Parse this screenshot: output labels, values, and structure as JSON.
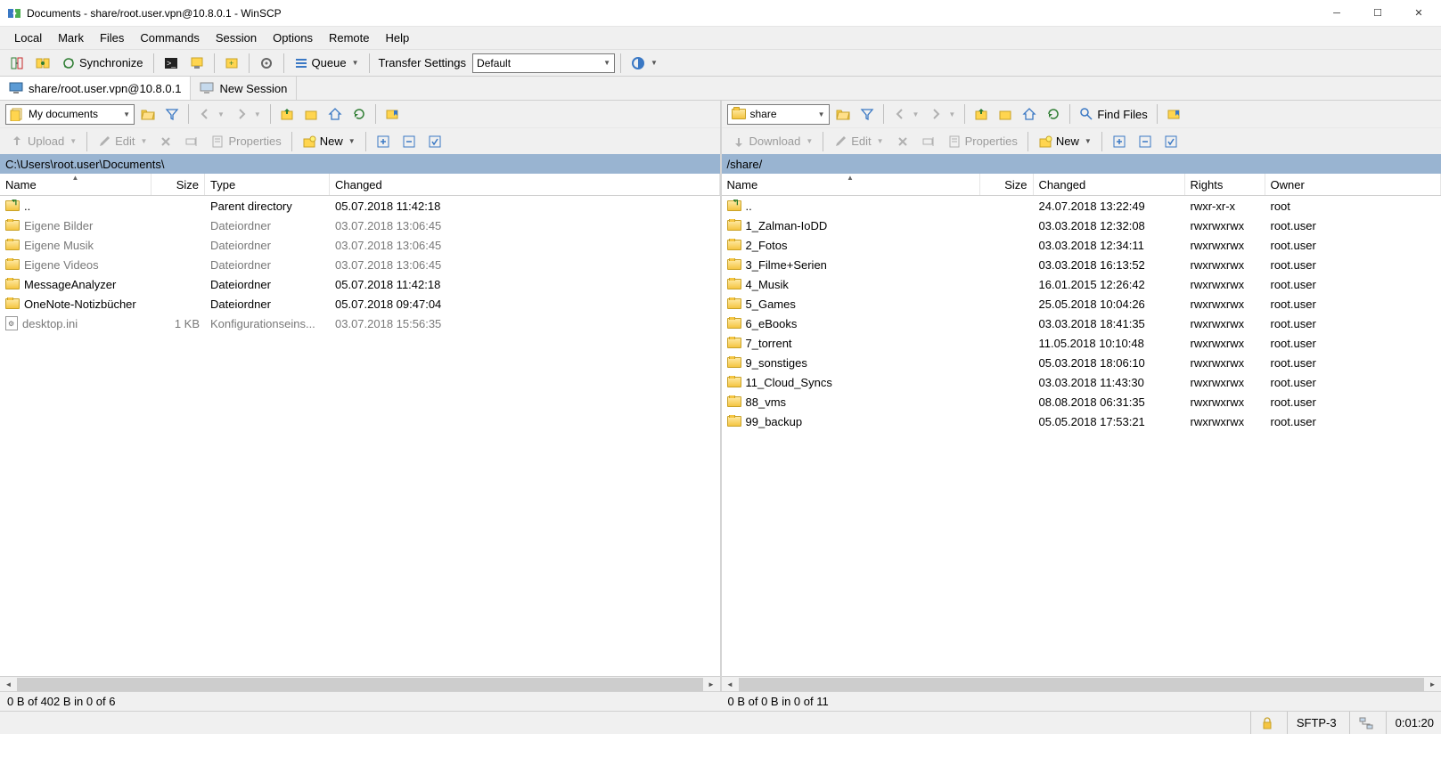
{
  "window": {
    "title": "Documents - share/root.user.vpn@10.8.0.1 - WinSCP"
  },
  "menubar": [
    "Local",
    "Mark",
    "Files",
    "Commands",
    "Session",
    "Options",
    "Remote",
    "Help"
  ],
  "toolbar1": {
    "synchronize": "Synchronize",
    "queue": "Queue",
    "transfer_label": "Transfer Settings",
    "transfer_value": "Default"
  },
  "sessions": {
    "active": "share/root.user.vpn@10.8.0.1",
    "new": "New Session"
  },
  "local": {
    "drive_label": "My documents",
    "actions": {
      "upload": "Upload",
      "edit": "Edit",
      "properties": "Properties",
      "new": "New"
    },
    "path": "C:\\Users\\root.user\\Documents\\",
    "headers": [
      "Name",
      "Size",
      "Type",
      "Changed"
    ],
    "rows": [
      {
        "icon": "up",
        "name": "..",
        "size": "",
        "type": "Parent directory",
        "changed": "05.07.2018  11:42:18",
        "dim": false
      },
      {
        "icon": "folder",
        "name": "Eigene Bilder",
        "size": "",
        "type": "Dateiordner",
        "changed": "03.07.2018  13:06:45",
        "dim": true
      },
      {
        "icon": "folder",
        "name": "Eigene Musik",
        "size": "",
        "type": "Dateiordner",
        "changed": "03.07.2018  13:06:45",
        "dim": true
      },
      {
        "icon": "folder",
        "name": "Eigene Videos",
        "size": "",
        "type": "Dateiordner",
        "changed": "03.07.2018  13:06:45",
        "dim": true
      },
      {
        "icon": "folder",
        "name": "MessageAnalyzer",
        "size": "",
        "type": "Dateiordner",
        "changed": "05.07.2018  11:42:18",
        "dim": false
      },
      {
        "icon": "folder",
        "name": "OneNote-Notizbücher",
        "size": "",
        "type": "Dateiordner",
        "changed": "05.07.2018  09:47:04",
        "dim": false
      },
      {
        "icon": "ini",
        "name": "desktop.ini",
        "size": "1 KB",
        "type": "Konfigurationseins...",
        "changed": "03.07.2018  15:56:35",
        "dim": true
      }
    ],
    "status": "0 B of 402 B in 0 of 6"
  },
  "remote": {
    "drive_label": "share",
    "find_files": "Find Files",
    "actions": {
      "download": "Download",
      "edit": "Edit",
      "properties": "Properties",
      "new": "New"
    },
    "path": "/share/",
    "headers": [
      "Name",
      "Size",
      "Changed",
      "Rights",
      "Owner"
    ],
    "rows": [
      {
        "icon": "up",
        "name": "..",
        "size": "",
        "changed": "24.07.2018 13:22:49",
        "rights": "rwxr-xr-x",
        "owner": "root"
      },
      {
        "icon": "folder",
        "name": "1_Zalman-IoDD",
        "size": "",
        "changed": "03.03.2018 12:32:08",
        "rights": "rwxrwxrwx",
        "owner": "root.user"
      },
      {
        "icon": "folder",
        "name": "2_Fotos",
        "size": "",
        "changed": "03.03.2018 12:34:11",
        "rights": "rwxrwxrwx",
        "owner": "root.user"
      },
      {
        "icon": "folder",
        "name": "3_Filme+Serien",
        "size": "",
        "changed": "03.03.2018 16:13:52",
        "rights": "rwxrwxrwx",
        "owner": "root.user"
      },
      {
        "icon": "folder",
        "name": "4_Musik",
        "size": "",
        "changed": "16.01.2015 12:26:42",
        "rights": "rwxrwxrwx",
        "owner": "root.user"
      },
      {
        "icon": "folder",
        "name": "5_Games",
        "size": "",
        "changed": "25.05.2018 10:04:26",
        "rights": "rwxrwxrwx",
        "owner": "root.user"
      },
      {
        "icon": "folder",
        "name": "6_eBooks",
        "size": "",
        "changed": "03.03.2018 18:41:35",
        "rights": "rwxrwxrwx",
        "owner": "root.user"
      },
      {
        "icon": "folder",
        "name": "7_torrent",
        "size": "",
        "changed": "11.05.2018 10:10:48",
        "rights": "rwxrwxrwx",
        "owner": "root.user"
      },
      {
        "icon": "folder",
        "name": "9_sonstiges",
        "size": "",
        "changed": "05.03.2018 18:06:10",
        "rights": "rwxrwxrwx",
        "owner": "root.user"
      },
      {
        "icon": "folder",
        "name": "11_Cloud_Syncs",
        "size": "",
        "changed": "03.03.2018 11:43:30",
        "rights": "rwxrwxrwx",
        "owner": "root.user"
      },
      {
        "icon": "folder",
        "name": "88_vms",
        "size": "",
        "changed": "08.08.2018 06:31:35",
        "rights": "rwxrwxrwx",
        "owner": "root.user"
      },
      {
        "icon": "folder",
        "name": "99_backup",
        "size": "",
        "changed": "05.05.2018 17:53:21",
        "rights": "rwxrwxrwx",
        "owner": "root.user"
      }
    ],
    "status": "0 B of 0 B in 0 of 11"
  },
  "statusbar": {
    "protocol": "SFTP-3",
    "time": "0:01:20"
  },
  "local_cols": {
    "name": 170,
    "size": 60,
    "type": 140,
    "changed": 250
  },
  "remote_cols": {
    "name": 290,
    "size": 60,
    "changed": 170,
    "rights": 90,
    "owner": 80
  }
}
